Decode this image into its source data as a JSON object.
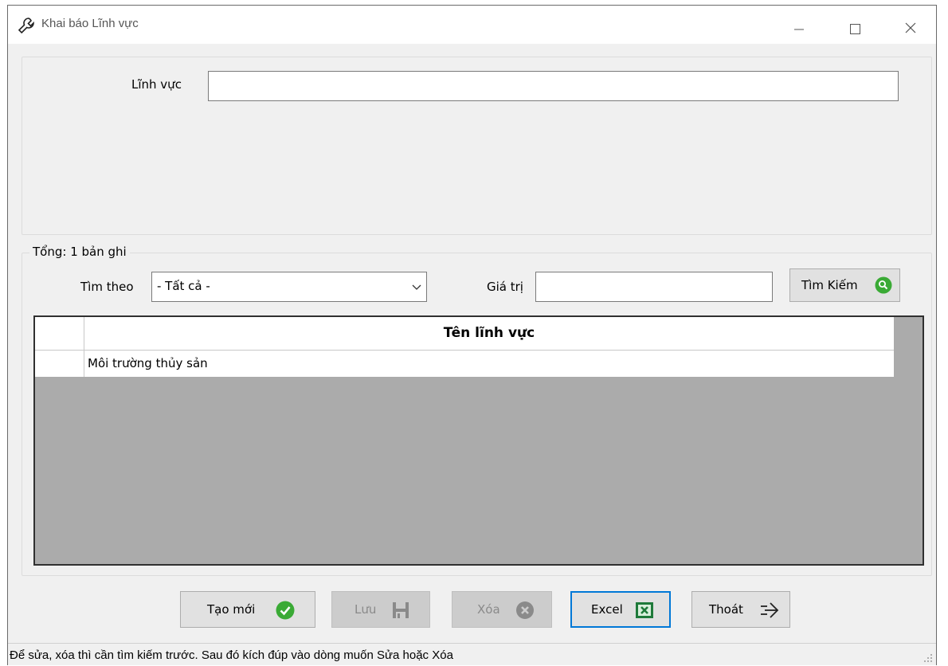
{
  "window": {
    "title": "Khai báo Lĩnh vực",
    "title_icon": "wrench-icon"
  },
  "form": {
    "linh_vuc_label": "Lĩnh vực",
    "linh_vuc_value": ""
  },
  "search": {
    "total_label": "Tổng: 1 bản ghi",
    "tim_theo_label": "Tìm theo",
    "tim_theo_selected": "- Tất cả -",
    "gia_tri_label": "Giá trị",
    "gia_tri_value": "",
    "search_button_label": "Tìm Kiếm"
  },
  "grid": {
    "columns": [
      "Tên lĩnh vực"
    ],
    "rows": [
      [
        "Môi trường thủy sản"
      ]
    ]
  },
  "buttons": {
    "tao_moi": "Tạo mới",
    "luu": "Lưu",
    "xoa": "Xóa",
    "excel": "Excel",
    "thoat": "Thoát"
  },
  "status": {
    "text": "Để sửa, xóa thì cần tìm kiếm trước. Sau đó kích đúp vào dòng muốn Sửa hoặc Xóa"
  },
  "colors": {
    "accent": "#0078d7",
    "ok_green": "#3aaa35",
    "grid_bg": "#ababab"
  }
}
